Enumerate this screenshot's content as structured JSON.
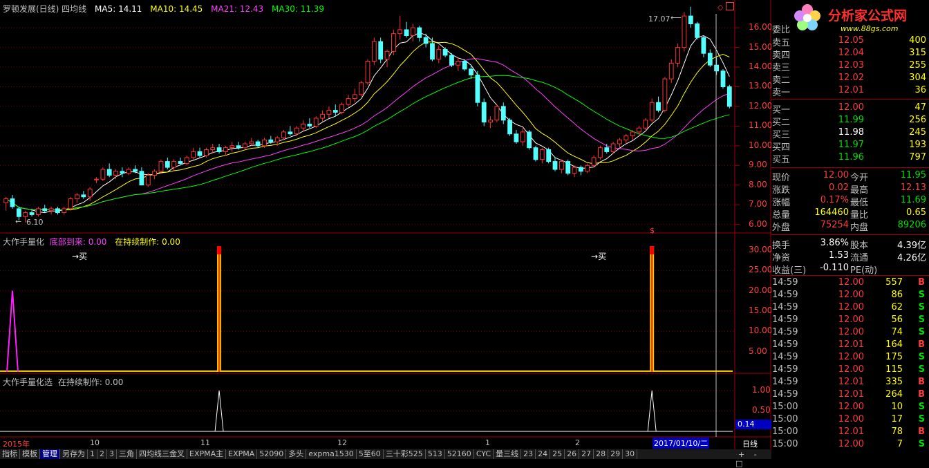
{
  "header": {
    "stock_title": "罗顿发展(日线) 四均线",
    "ma5": "MA5: 14.11",
    "ma10": "MA10: 14.45",
    "ma21": "MA21: 12.43",
    "ma30": "MA30: 11.39",
    "high_label": "17.07",
    "low_label": "6.10"
  },
  "sub1": {
    "title": "大作手量化",
    "line1": "底部到来: 0.00",
    "line2": "在持续制作: 0.00",
    "buy_label": "买"
  },
  "sub2": {
    "title": "大作手量化选",
    "line1": "在持续制作: 0.00",
    "current_value": "0.14"
  },
  "axes": {
    "main": [
      "16.00",
      "15.00",
      "14.00",
      "13.00",
      "12.00",
      "11.00",
      "10.00",
      "9.00",
      "8.00",
      "7.00",
      "6.00"
    ],
    "sub1": [
      "30.00",
      "25.00",
      "20.00",
      "15.00",
      "10.00",
      "5.00"
    ],
    "sub2": [
      "1.00",
      "0.50"
    ]
  },
  "dates": {
    "start": "2015年",
    "m10": "10",
    "m11": "11",
    "m12": "12",
    "m1": "1",
    "m2": "2",
    "cursor": "2017/01/10/二",
    "period": "日线"
  },
  "logo": {
    "title": "分析家公式网",
    "url": "www.88gs.com"
  },
  "order_book": {
    "header": "委比",
    "asks": [
      {
        "label": "卖五",
        "price": "12.05",
        "vol": "400"
      },
      {
        "label": "卖四",
        "price": "12.04",
        "vol": "315"
      },
      {
        "label": "卖三",
        "price": "12.03",
        "vol": "255"
      },
      {
        "label": "卖二",
        "price": "12.02",
        "vol": "304"
      },
      {
        "label": "卖一",
        "price": "12.01",
        "vol": "36"
      }
    ],
    "bids": [
      {
        "label": "买一",
        "price": "12.00",
        "vol": "47"
      },
      {
        "label": "买二",
        "price": "11.99",
        "vol": "256"
      },
      {
        "label": "买三",
        "price": "11.98",
        "vol": "245"
      },
      {
        "label": "买四",
        "price": "11.97",
        "vol": "193"
      },
      {
        "label": "买五",
        "price": "11.96",
        "vol": "797"
      }
    ]
  },
  "quote": [
    {
      "l1": "现价",
      "v1": "12.00",
      "l2": "今开",
      "v2": "11.95"
    },
    {
      "l1": "涨跌",
      "v1": "0.02",
      "l2": "最高",
      "v2": "12.13"
    },
    {
      "l1": "涨幅",
      "v1": "0.17%",
      "l2": "最低",
      "v2": "11.69"
    },
    {
      "l1": "总量",
      "v1": "164460",
      "l2": "量比",
      "v2": "0.65"
    },
    {
      "l1": "外盘",
      "v1": "75254",
      "l2": "内盘",
      "v2": "89206"
    },
    {
      "l1": "换手",
      "v1": "3.86%",
      "l2": "股本",
      "v2": "4.39亿"
    },
    {
      "l1": "净资",
      "v1": "1.53",
      "l2": "流通",
      "v2": "4.26亿"
    },
    {
      "l1": "收益(三)",
      "v1": "-0.110",
      "l2": "PE(动)",
      "v2": ""
    }
  ],
  "ticks": [
    {
      "t": "14:59",
      "p": "12.00",
      "v": "557",
      "d": "B"
    },
    {
      "t": "14:59",
      "p": "12.00",
      "v": "86",
      "d": "S"
    },
    {
      "t": "14:59",
      "p": "12.00",
      "v": "62",
      "d": "S"
    },
    {
      "t": "14:59",
      "p": "12.00",
      "v": "56",
      "d": "S"
    },
    {
      "t": "14:59",
      "p": "12.00",
      "v": "74",
      "d": "S"
    },
    {
      "t": "14:59",
      "p": "12.01",
      "v": "164",
      "d": "B"
    },
    {
      "t": "14:59",
      "p": "12.00",
      "v": "175",
      "d": "S"
    },
    {
      "t": "14:59",
      "p": "12.00",
      "v": "115",
      "d": "S"
    },
    {
      "t": "14:59",
      "p": "12.01",
      "v": "335",
      "d": "B"
    },
    {
      "t": "14:59",
      "p": "12.01",
      "v": "264",
      "d": "B"
    },
    {
      "t": "15:00",
      "p": "12.00",
      "v": "10",
      "d": "S"
    },
    {
      "t": "15:00",
      "p": "12.00",
      "v": "17",
      "d": "S"
    },
    {
      "t": "15:00",
      "p": "12.01",
      "v": "78",
      "d": "B"
    },
    {
      "t": "15:00",
      "p": "12.00",
      "v": "7",
      "d": "S"
    }
  ],
  "toolbar": [
    "指标",
    "模板",
    "管理",
    "另存为",
    "1",
    "2",
    "3",
    "三角",
    "四均线三金叉",
    "EXPMA主",
    "EXPMA",
    "52090",
    "多头",
    "expma1530",
    "5至60",
    "三十彩525",
    "513",
    "52160",
    "CYC",
    "量三线",
    "23",
    "24",
    "25",
    "26",
    "27",
    "28",
    "29",
    "30"
  ],
  "toolbar_active": "管理",
  "scroll_buttons": [
    "+",
    "-",
    "□"
  ],
  "colors": {
    "up": "#ff3232",
    "down": "#54ffff",
    "ma5": "#ffffff",
    "ma10": "#ffff00",
    "ma21": "#ff40ff",
    "ma30": "#00ff00"
  },
  "chart_data": {
    "type": "candlestick",
    "title": "罗顿发展(日线)",
    "ylim": [
      5.6,
      17.2
    ],
    "candles": [
      [
        7.1,
        7.4,
        6.7,
        7.3
      ],
      [
        7.3,
        7.5,
        6.8,
        6.9
      ],
      [
        6.8,
        6.9,
        6.2,
        6.4
      ],
      [
        6.4,
        6.7,
        6.1,
        6.6
      ],
      [
        6.6,
        6.8,
        6.4,
        6.5
      ],
      [
        6.5,
        6.9,
        6.4,
        6.8
      ],
      [
        6.8,
        7.0,
        6.6,
        6.7
      ],
      [
        6.7,
        6.9,
        6.5,
        6.8
      ],
      [
        6.8,
        6.9,
        6.5,
        6.6
      ],
      [
        6.6,
        6.9,
        6.5,
        6.8
      ],
      [
        6.8,
        7.4,
        6.7,
        7.3
      ],
      [
        7.3,
        7.6,
        7.1,
        7.5
      ],
      [
        7.5,
        7.7,
        7.3,
        7.4
      ],
      [
        7.4,
        7.9,
        7.2,
        7.8
      ],
      [
        8.3,
        8.4,
        8.1,
        8.3
      ],
      [
        8.3,
        8.9,
        8.2,
        8.8
      ],
      [
        8.8,
        9.1,
        8.4,
        8.5
      ],
      [
        8.5,
        8.8,
        8.3,
        8.7
      ],
      [
        8.7,
        8.9,
        8.4,
        8.6
      ],
      [
        8.6,
        8.9,
        8.5,
        8.8
      ],
      [
        8.8,
        9.0,
        8.6,
        8.7
      ],
      [
        8.7,
        8.9,
        8.0,
        8.0
      ],
      [
        8.0,
        8.6,
        7.9,
        8.5
      ],
      [
        8.5,
        8.8,
        8.3,
        8.7
      ],
      [
        8.7,
        9.3,
        8.6,
        9.2
      ],
      [
        9.2,
        9.4,
        8.8,
        8.9
      ],
      [
        8.9,
        9.3,
        8.7,
        9.2
      ],
      [
        9.2,
        9.4,
        9.0,
        9.1
      ],
      [
        9.1,
        9.5,
        9.0,
        9.4
      ],
      [
        9.4,
        9.9,
        9.3,
        9.7
      ],
      [
        9.7,
        9.9,
        9.4,
        9.5
      ],
      [
        9.5,
        9.9,
        9.4,
        9.8
      ],
      [
        9.8,
        10.1,
        9.6,
        9.9
      ],
      [
        9.9,
        10.1,
        9.6,
        9.7
      ],
      [
        9.7,
        10.0,
        9.5,
        9.9
      ],
      [
        9.9,
        10.2,
        9.7,
        10.0
      ],
      [
        10.0,
        10.2,
        9.8,
        9.9
      ],
      [
        9.9,
        10.2,
        9.8,
        10.1
      ],
      [
        10.1,
        10.4,
        10.0,
        10.2
      ],
      [
        10.2,
        10.3,
        9.9,
        10.0
      ],
      [
        10.0,
        10.4,
        9.9,
        10.3
      ],
      [
        10.3,
        10.5,
        10.1,
        10.2
      ],
      [
        10.2,
        10.5,
        10.0,
        10.4
      ],
      [
        10.4,
        10.8,
        10.3,
        10.7
      ],
      [
        10.7,
        11.0,
        10.5,
        10.6
      ],
      [
        10.6,
        11.0,
        10.5,
        10.9
      ],
      [
        10.9,
        11.3,
        10.7,
        11.1
      ],
      [
        11.1,
        11.4,
        10.9,
        11.0
      ],
      [
        11.0,
        11.5,
        10.9,
        11.4
      ],
      [
        11.4,
        11.8,
        11.2,
        11.6
      ],
      [
        11.6,
        12.0,
        11.4,
        11.8
      ],
      [
        11.8,
        12.1,
        11.5,
        11.7
      ],
      [
        11.7,
        12.2,
        11.6,
        12.1
      ],
      [
        12.1,
        12.6,
        12.0,
        12.4
      ],
      [
        12.4,
        12.9,
        12.2,
        12.6
      ],
      [
        12.6,
        13.3,
        12.5,
        13.2
      ],
      [
        13.2,
        14.4,
        13.1,
        14.3
      ],
      [
        14.3,
        15.5,
        14.1,
        15.3
      ],
      [
        15.3,
        15.5,
        14.2,
        14.4
      ],
      [
        14.4,
        14.9,
        14.0,
        14.8
      ],
      [
        14.8,
        15.9,
        14.6,
        15.7
      ],
      [
        15.7,
        16.6,
        15.4,
        15.9
      ],
      [
        15.9,
        16.3,
        15.5,
        15.6
      ],
      [
        15.6,
        16.2,
        15.3,
        16.0
      ],
      [
        16.0,
        16.1,
        15.3,
        15.5
      ],
      [
        15.5,
        15.7,
        15.0,
        15.2
      ],
      [
        15.2,
        15.5,
        14.3,
        14.4
      ],
      [
        14.4,
        15.1,
        14.2,
        14.9
      ],
      [
        14.9,
        15.0,
        14.5,
        14.6
      ],
      [
        14.6,
        14.7,
        14.0,
        14.1
      ],
      [
        14.1,
        14.5,
        13.8,
        14.3
      ],
      [
        14.3,
        14.4,
        13.8,
        13.9
      ],
      [
        13.9,
        14.1,
        13.4,
        13.6
      ],
      [
        13.6,
        13.8,
        12.0,
        12.2
      ],
      [
        12.2,
        12.4,
        11.0,
        11.2
      ],
      [
        11.2,
        11.5,
        10.9,
        11.3
      ],
      [
        11.3,
        12.1,
        11.2,
        12.0
      ],
      [
        12.0,
        12.2,
        11.1,
        11.3
      ],
      [
        11.3,
        11.4,
        10.5,
        10.6
      ],
      [
        10.6,
        10.8,
        10.1,
        10.2
      ],
      [
        10.2,
        10.9,
        10.0,
        10.7
      ],
      [
        10.7,
        10.8,
        9.8,
        9.9
      ],
      [
        9.9,
        10.0,
        9.2,
        9.3
      ],
      [
        9.3,
        9.9,
        9.1,
        9.8
      ],
      [
        9.8,
        9.9,
        9.1,
        9.2
      ],
      [
        9.2,
        9.4,
        8.7,
        8.8
      ],
      [
        8.8,
        9.3,
        8.6,
        9.2
      ],
      [
        9.2,
        9.3,
        8.5,
        8.6
      ],
      [
        8.6,
        9.0,
        8.4,
        8.9
      ],
      [
        8.9,
        9.0,
        8.5,
        8.7
      ],
      [
        8.7,
        9.1,
        8.6,
        9.0
      ],
      [
        9.0,
        9.5,
        8.9,
        9.4
      ],
      [
        9.4,
        10.0,
        9.3,
        9.9
      ],
      [
        9.9,
        10.1,
        9.6,
        9.7
      ],
      [
        9.7,
        10.2,
        9.6,
        10.1
      ],
      [
        10.1,
        10.4,
        9.9,
        10.3
      ],
      [
        10.3,
        10.6,
        10.1,
        10.5
      ],
      [
        10.5,
        10.8,
        10.3,
        10.7
      ],
      [
        10.7,
        11.0,
        10.5,
        10.9
      ],
      [
        10.9,
        11.4,
        10.8,
        11.3
      ],
      [
        11.3,
        12.4,
        11.2,
        12.2
      ],
      [
        12.2,
        12.5,
        11.7,
        11.8
      ],
      [
        11.8,
        13.5,
        11.7,
        13.4
      ],
      [
        13.4,
        14.4,
        13.2,
        14.2
      ],
      [
        14.2,
        15.2,
        14.0,
        15.0
      ],
      [
        15.0,
        16.8,
        14.8,
        16.6
      ],
      [
        16.6,
        17.07,
        16.0,
        16.2
      ],
      [
        16.2,
        16.3,
        15.4,
        15.5
      ],
      [
        15.5,
        15.6,
        14.5,
        14.7
      ],
      [
        14.7,
        14.9,
        14.0,
        14.1
      ],
      [
        14.1,
        14.5,
        13.6,
        13.8
      ],
      [
        13.8,
        13.9,
        12.9,
        13.0
      ],
      [
        13.0,
        13.1,
        11.9,
        12.0
      ]
    ],
    "signals": {
      "sub1_spikes": [
        33,
        100
      ],
      "sub1_pink_spike": 1,
      "sub2_spikes": [
        33,
        100
      ]
    },
    "ma_periods": [
      5,
      10,
      21,
      30
    ]
  }
}
